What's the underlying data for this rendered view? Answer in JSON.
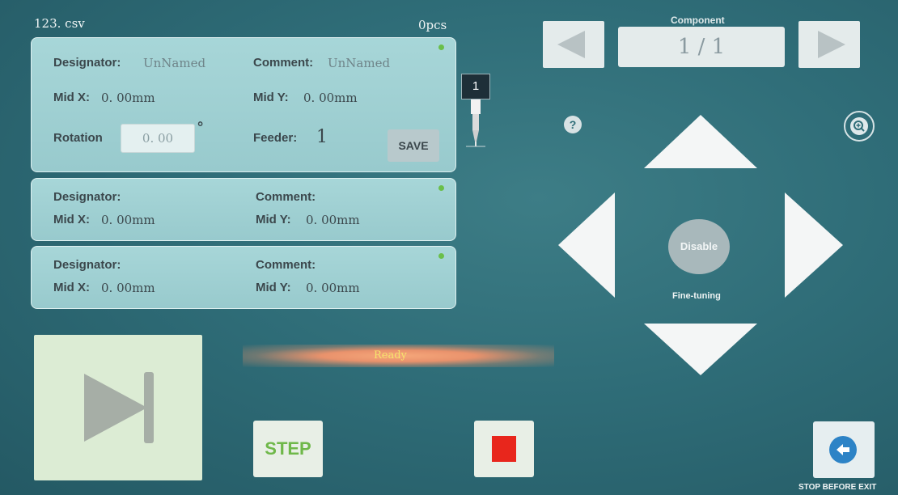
{
  "header": {
    "file_name": "123. csv",
    "count": "0pcs"
  },
  "component": {
    "label": "Component",
    "index": "1  /  1"
  },
  "cards": [
    {
      "designator_label": "Designator:",
      "designator_value": "UnNamed",
      "comment_label": "Comment:",
      "comment_value": "UnNamed",
      "midx_label": "Mid X:",
      "midx_value": "0. 00mm",
      "midy_label": "Mid Y:",
      "midy_value": "0. 00mm",
      "rotation_label": "Rotation",
      "rotation_value": "0. 00",
      "degree_symbol": "°",
      "feeder_label": "Feeder:",
      "feeder_value": "1",
      "save_label": "SAVE"
    },
    {
      "designator_label": "Designator:",
      "comment_label": "Comment:",
      "midx_label": "Mid X:",
      "midx_value": "0. 00mm",
      "midy_label": "Mid Y:",
      "midy_value": "0. 00mm"
    },
    {
      "designator_label": "Designator:",
      "comment_label": "Comment:",
      "midx_label": "Mid X:",
      "midx_value": "0. 00mm",
      "midy_label": "Mid Y:",
      "midy_value": "0. 00mm"
    }
  ],
  "nozzle": {
    "number": "1"
  },
  "controls": {
    "help": "?",
    "disable_label": "Disable",
    "fine_tuning_label": "Fine-tuning",
    "step_label": "STEP",
    "status": "Ready",
    "exit_label": "STOP BEFORE EXIT"
  },
  "colors": {
    "accent_green": "#6fb84a",
    "stop_red": "#e8261c",
    "exit_blue": "#2d83c6",
    "status_yellow": "#f6e36c"
  },
  "icons": [
    "prev-arrow-icon",
    "next-arrow-icon",
    "help-icon",
    "zoom-in-icon",
    "arrow-up-icon",
    "arrow-down-icon",
    "arrow-left-icon",
    "arrow-right-icon",
    "play-skip-icon",
    "stop-icon",
    "back-arrow-icon",
    "nozzle-icon"
  ]
}
